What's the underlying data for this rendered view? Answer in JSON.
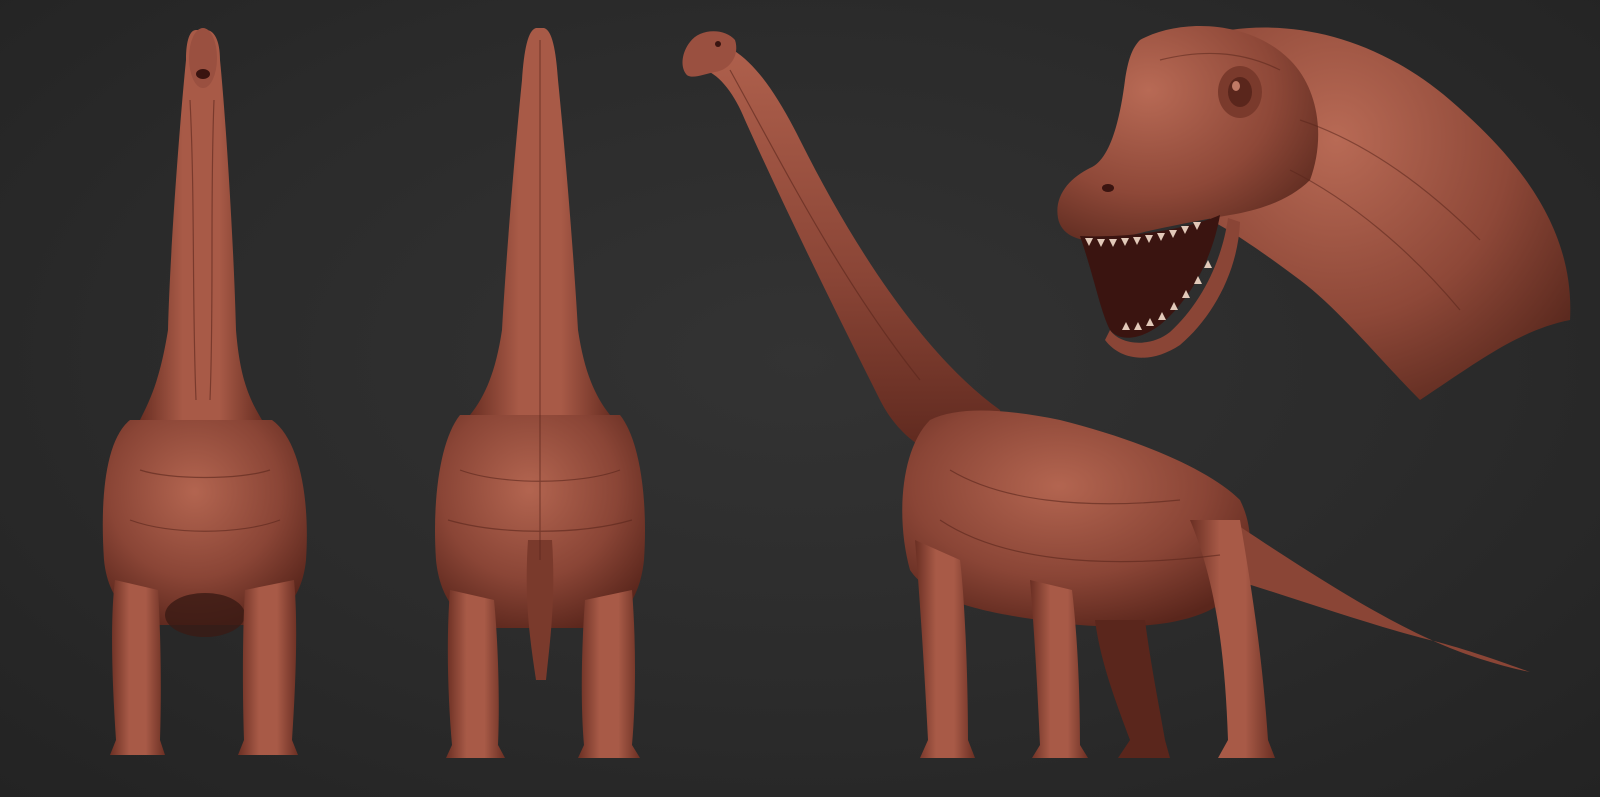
{
  "scene": {
    "colors": {
      "background": "#2b2b2b",
      "skin": "#8a4536",
      "skin_light": "#b0614d",
      "skin_dark": "#4a1f18",
      "mouth": "#3a1410",
      "teeth": "#e2c9b9"
    },
    "views": [
      {
        "name": "front"
      },
      {
        "name": "back"
      },
      {
        "name": "side"
      },
      {
        "name": "head-closeup"
      }
    ]
  }
}
